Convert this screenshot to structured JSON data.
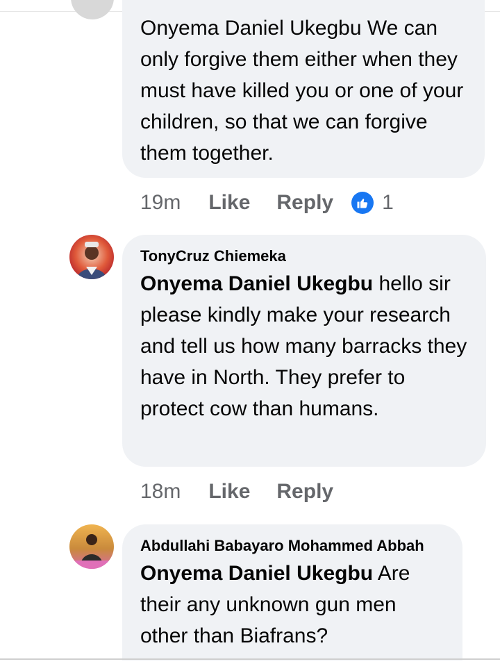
{
  "comments": [
    {
      "author": "",
      "mention": "",
      "text": "Onyema Daniel Ukegbu We can only forgive them either when they must have killed you or one of your children, so that we can forgive them together.",
      "time": "19m",
      "like_label": "Like",
      "reply_label": "Reply",
      "reaction_count": "1",
      "reaction_icon": "like-thumb-icon",
      "reaction_color": "#1877f2"
    },
    {
      "author": "TonyCruz Chiemeka",
      "mention": "Onyema Daniel Ukegbu",
      "text": " hello sir please kindly make your research and tell us how many barracks they have in North. They prefer to protect cow than humans.",
      "time": "18m",
      "like_label": "Like",
      "reply_label": "Reply"
    },
    {
      "author": "Abdullahi Babayaro Mohammed Abbah",
      "mention": "Onyema Daniel Ukegbu",
      "text": " Are their any unknown gun men other than Biafrans?"
    }
  ],
  "colors": {
    "bubble": "#f0f2f5",
    "meta_text": "#65676b",
    "primary_text": "#050505"
  }
}
